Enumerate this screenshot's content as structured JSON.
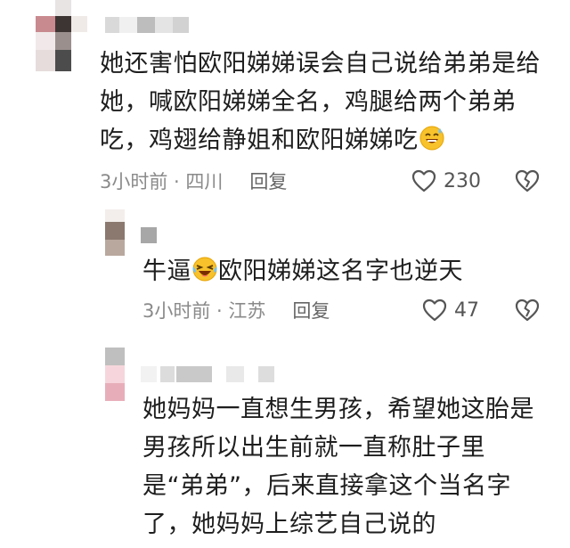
{
  "comments": [
    {
      "text_before_emoji": "她还害怕欧阳娣娣误会自己说给弟弟是给她，喊欧阳娣娣全名，鸡腿给两个弟弟吃，鸡翅给静姐和欧阳娣娣吃",
      "text_after_emoji": "",
      "emoji": "sweat-smile-emoji",
      "time_location": "3小时前 · 四川",
      "reply_label": "回复",
      "like_count": "230"
    },
    {
      "text_before_emoji": "牛逼",
      "text_after_emoji": "欧阳娣娣这名字也逆天",
      "emoji": "laughing-crying-emoji",
      "time_location": "3小时前 · 江苏",
      "reply_label": "回复",
      "like_count": "47"
    },
    {
      "text_before_emoji": "她妈妈一直想生男孩，希望她这胎是男孩所以出生前就一直称肚子里是“弟弟”，后来直接拿这个当名字了，她妈妈上综艺自己说的",
      "text_after_emoji": "",
      "emoji": "",
      "time_location": "",
      "reply_label": "",
      "like_count": ""
    }
  ],
  "colors": {
    "text": "#1e1e1e",
    "meta": "#8a8a8a",
    "icon": "#555555",
    "background": "#ffffff"
  }
}
